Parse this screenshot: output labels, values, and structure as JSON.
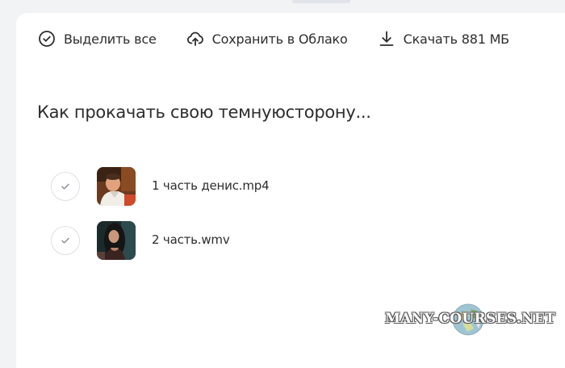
{
  "toolbar": {
    "select_all_label": "Выделить все",
    "save_label": "Сохранить в Облако",
    "download_label": "Скачать 881 МБ"
  },
  "folder": {
    "title": "Как прокачать свою темнуюсторону..."
  },
  "files": [
    {
      "name": "1 часть денис.mp4",
      "type": "video-mp4"
    },
    {
      "name": "2 часть.wmv",
      "type": "video-wmv"
    }
  ],
  "watermark": {
    "text": "MANY-COURSES.NET"
  },
  "icons": {
    "select_all": "check-circle-icon",
    "save": "cloud-upload-icon",
    "download": "download-icon",
    "row_check": "checkmark-icon"
  },
  "colors": {
    "background": "#f2f3f5",
    "panel": "#ffffff",
    "text": "#2c2d2e",
    "checkbox_border": "#dcdfe4"
  }
}
